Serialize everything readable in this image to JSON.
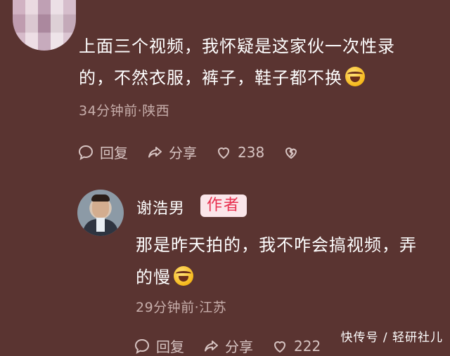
{
  "comment": {
    "text_line1": "上面三个视频，我怀疑是这家伙一次性录",
    "text_line2": "的，不然衣服，裤子，鞋子都不换",
    "emoji_icon": "rofl-emoji-icon",
    "time_location": "34分钟前·陕西",
    "actions": {
      "reply_label": "回复",
      "share_label": "分享",
      "like_count": "238"
    }
  },
  "reply": {
    "author_name": "谢浩男",
    "author_badge": "作者",
    "text_line1": "那是昨天拍的，我不咋会搞视频，弄",
    "text_line2": "的慢",
    "emoji_icon": "rofl-emoji-icon",
    "time_location": "29分钟前·江苏",
    "actions": {
      "reply_label": "回复",
      "share_label": "分享",
      "like_count": "222"
    }
  },
  "watermark": "快传号 / 轻研社儿",
  "colors": {
    "background": "#5a3431",
    "author_badge_bg": "#fbe6ea",
    "author_badge_text": "#e8304f",
    "meta_text": "#c7aeab"
  }
}
